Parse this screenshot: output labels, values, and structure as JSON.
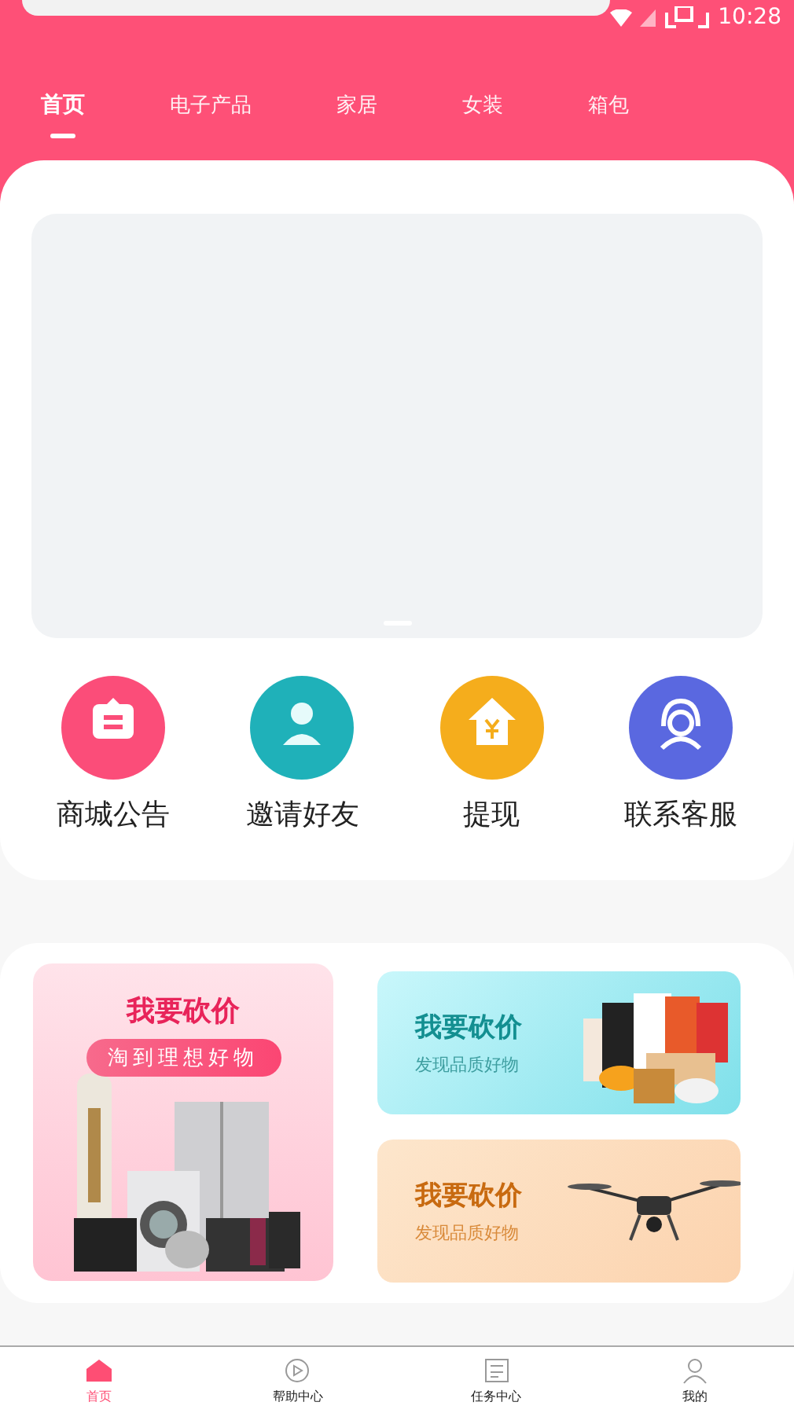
{
  "status_bar": {
    "time": "10:28"
  },
  "tabs": [
    {
      "label": "首页",
      "selected": true
    },
    {
      "label": "电子产品",
      "selected": false
    },
    {
      "label": "家居",
      "selected": false
    },
    {
      "label": "女装",
      "selected": false
    },
    {
      "label": "箱包",
      "selected": false
    }
  ],
  "shortcuts": [
    {
      "label": "商城公告",
      "kind": "notice",
      "color": "#fb4d79"
    },
    {
      "label": "邀请好友",
      "kind": "friends",
      "color": "#1fb1b9"
    },
    {
      "label": "提现",
      "kind": "withdraw",
      "color": "#f5ad1c"
    },
    {
      "label": "联系客服",
      "kind": "service",
      "color": "#5a68e0"
    }
  ],
  "promos": [
    {
      "kind": "large",
      "title": "我要砍价",
      "subtitle": "淘到理想好物"
    },
    {
      "kind": "teal",
      "title": "我要砍价",
      "subtitle": "发现品质好物"
    },
    {
      "kind": "orange",
      "title": "我要砍价",
      "subtitle": "发现品质好物"
    }
  ],
  "bottom_nav": [
    {
      "label": "首页",
      "kind": "home",
      "selected": true
    },
    {
      "label": "帮助中心",
      "kind": "play",
      "selected": false
    },
    {
      "label": "任务中心",
      "kind": "list",
      "selected": false
    },
    {
      "label": "我的",
      "kind": "user",
      "selected": false
    }
  ]
}
